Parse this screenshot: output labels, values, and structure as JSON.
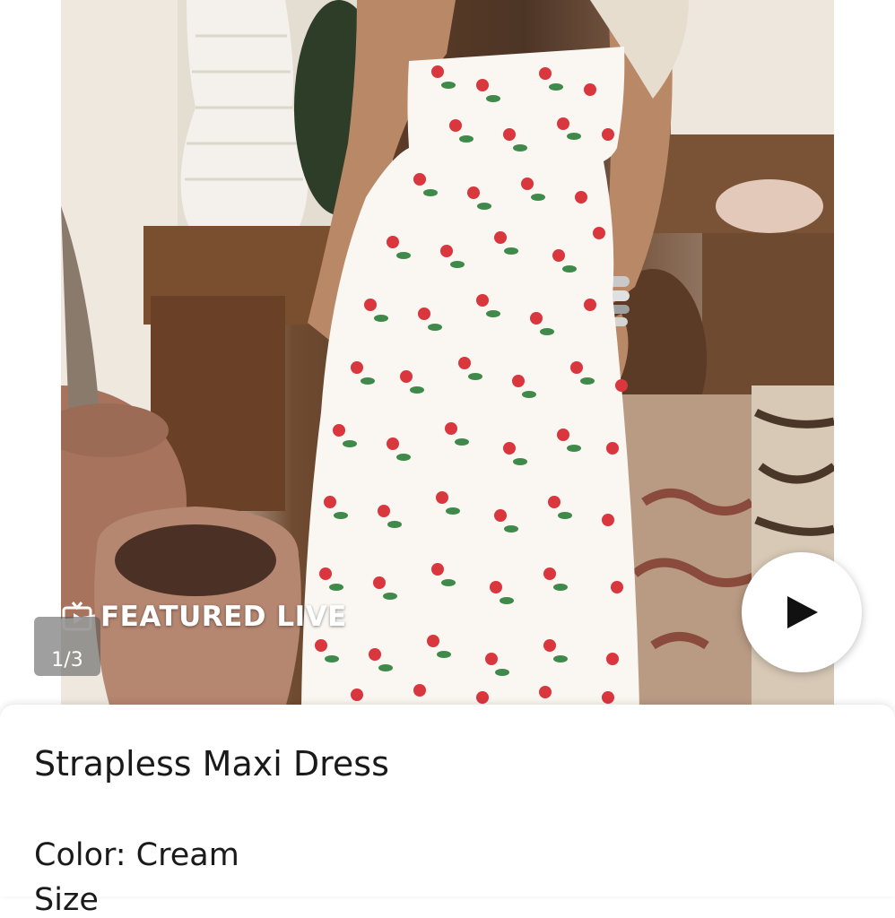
{
  "overlay": {
    "featured_label": "FEATURED LIVE",
    "image_counter": "1/3"
  },
  "product": {
    "title": "Strapless Maxi Dress",
    "color_line": "Color: Cream",
    "size_line": "Size"
  },
  "colors": {
    "dress_base": "#faf6f1",
    "strawberry": "#d9363e",
    "leaf": "#3f8a4a",
    "play_icon": "#111111"
  },
  "icons": {
    "tv": "tv-play-icon",
    "play": "play-icon"
  }
}
